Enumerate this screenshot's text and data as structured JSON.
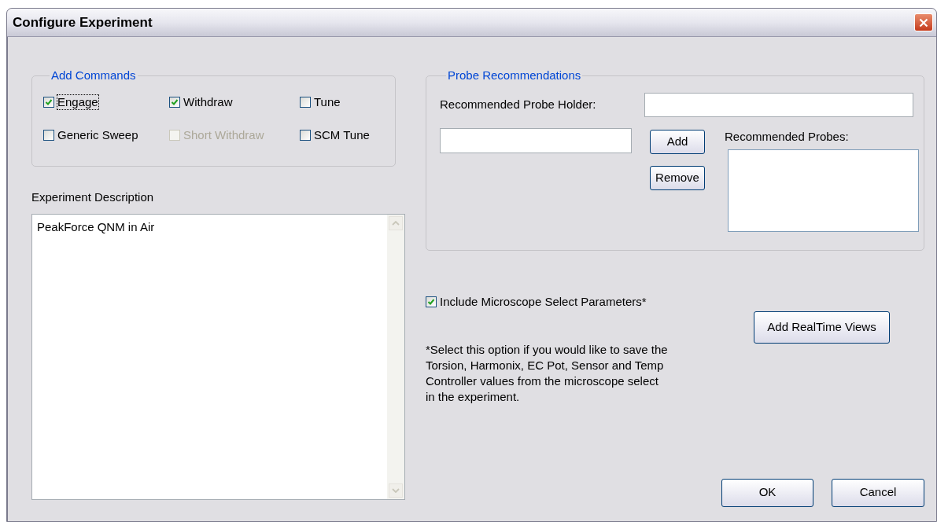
{
  "window": {
    "title": "Configure Experiment"
  },
  "add_commands": {
    "title": "Add Commands",
    "options": [
      {
        "label": "Engage",
        "checked": true,
        "disabled": false,
        "focused": true
      },
      {
        "label": "Withdraw",
        "checked": true,
        "disabled": false,
        "focused": false
      },
      {
        "label": "Tune",
        "checked": false,
        "disabled": false,
        "focused": false
      },
      {
        "label": "Generic Sweep",
        "checked": false,
        "disabled": false,
        "focused": false
      },
      {
        "label": "Short Withdraw",
        "checked": false,
        "disabled": true,
        "focused": false
      },
      {
        "label": "SCM Tune",
        "checked": false,
        "disabled": false,
        "focused": false
      }
    ]
  },
  "experiment_description": {
    "label": "Experiment Description",
    "value": "PeakForce QNM in Air"
  },
  "probe_recommendations": {
    "title": "Probe Recommendations",
    "holder_label": "Recommended Probe Holder:",
    "add_button": "Add",
    "remove_button": "Remove",
    "probes_label": "Recommended Probes:"
  },
  "include_microscope": {
    "label": "Include Microscope Select Parameters*",
    "checked": true
  },
  "note": "*Select this option if you would like to save the Torsion, Harmonix, EC Pot, Sensor and Temp Controller values from the microscope select in the experiment.",
  "buttons": {
    "realtime": "Add RealTime Views",
    "ok": "OK",
    "cancel": "Cancel"
  }
}
